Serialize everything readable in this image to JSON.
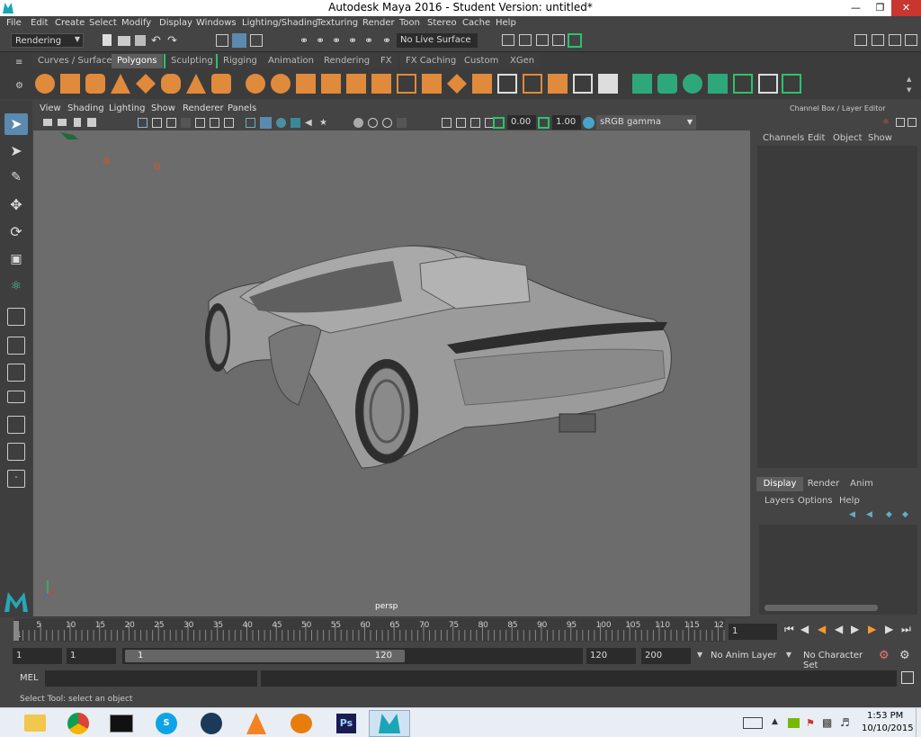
{
  "window": {
    "title": "Autodesk Maya 2016 - Student Version: untitled*"
  },
  "menubar": {
    "items": [
      "File",
      "Edit",
      "Create",
      "Select",
      "Modify",
      "Display",
      "Windows",
      "Lighting/Shading",
      "Texturing",
      "Render",
      "Toon",
      "Stereo",
      "Cache",
      "Help"
    ]
  },
  "statusline": {
    "mode": "Rendering",
    "live_surface": "No Live Surface"
  },
  "shelf": {
    "tabs": [
      "Curves / Surfaces",
      "Polygons",
      "Sculpting",
      "Rigging",
      "Animation",
      "Rendering",
      "FX",
      "FX Caching",
      "Custom",
      "XGen"
    ],
    "active_tab": "Polygons"
  },
  "viewport": {
    "menu": [
      "View",
      "Shading",
      "Lighting",
      "Show",
      "Renderer",
      "Panels"
    ],
    "exposure": "0.00",
    "gamma": "1.00",
    "colorspace": "sRGB gamma",
    "camera_label": "persp"
  },
  "channelbox": {
    "title": "Channel Box / Layer Editor",
    "menu": [
      "Channels",
      "Edit",
      "Object",
      "Show"
    ],
    "layer_tabs": [
      "Display",
      "Render",
      "Anim"
    ],
    "active_layer_tab": "Display",
    "layer_menu": [
      "Layers",
      "Options",
      "Help"
    ]
  },
  "timeline": {
    "ticks": [
      "1",
      "5",
      "10",
      "15",
      "20",
      "25",
      "30",
      "35",
      "40",
      "45",
      "50",
      "55",
      "60",
      "65",
      "70",
      "75",
      "80",
      "85",
      "90",
      "95",
      "100",
      "105",
      "110",
      "115",
      "12"
    ],
    "current_frame": "1"
  },
  "range": {
    "start": "1",
    "start_inner": "1",
    "slider_start": "1",
    "slider_end": "120",
    "end_inner": "120",
    "end": "200",
    "anim_layer": "No Anim Layer",
    "char_set": "No Character Set"
  },
  "mel": {
    "label": "MEL"
  },
  "help": {
    "text": "Select Tool: select an object"
  },
  "taskbar": {
    "time": "1:53 PM",
    "date": "10/10/2015"
  }
}
